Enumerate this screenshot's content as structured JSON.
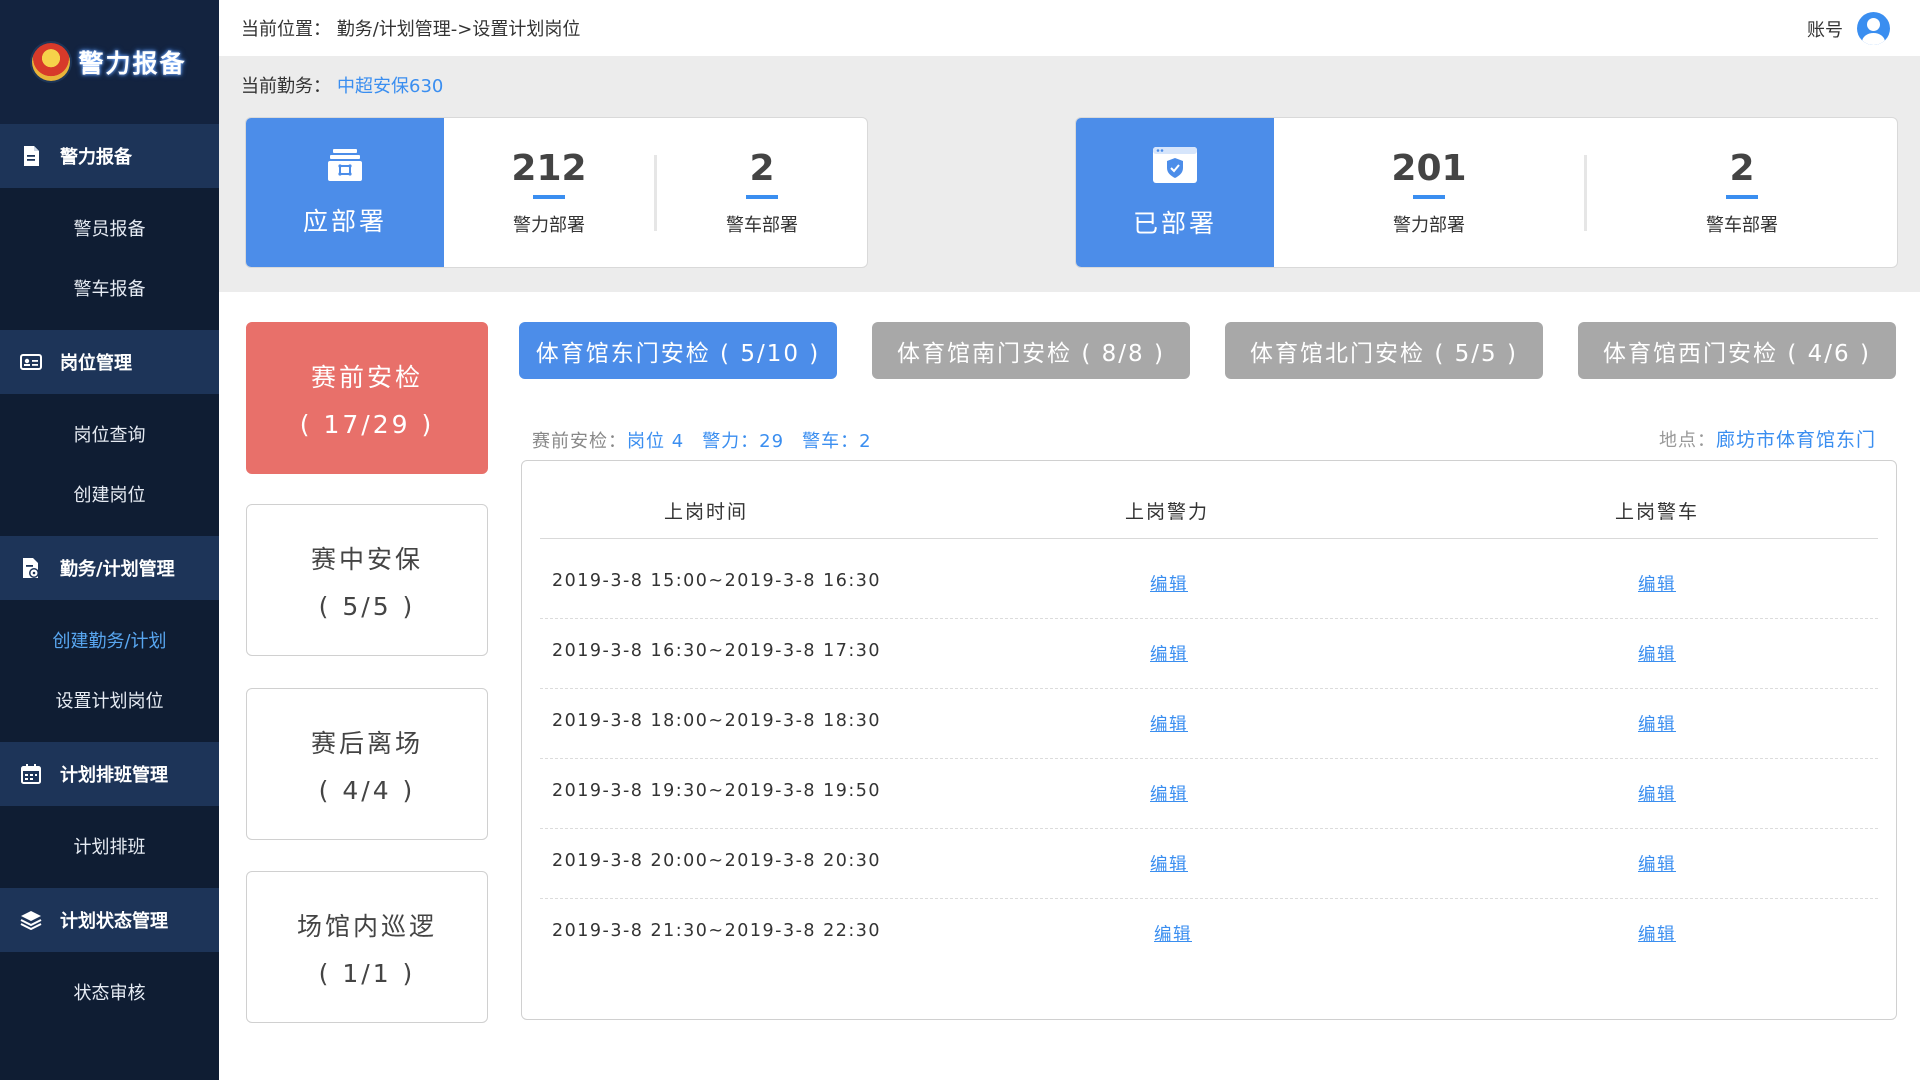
{
  "app": {
    "logo_text": "警力报备"
  },
  "sidebar": {
    "groups": [
      {
        "title": "警力报备",
        "icon": "document-icon",
        "items": [
          "警员报备",
          "警车报备"
        ]
      },
      {
        "title": "岗位管理",
        "icon": "id-card-icon",
        "items": [
          "岗位查询",
          "创建岗位"
        ]
      },
      {
        "title": "勤务/计划管理",
        "icon": "file-gear-icon",
        "items": [
          "创建勤务/计划",
          "设置计划岗位"
        ]
      },
      {
        "title": "计划排班管理",
        "icon": "calendar-icon",
        "items": [
          "计划排班"
        ]
      },
      {
        "title": "计划状态管理",
        "icon": "layers-icon",
        "items": [
          "状态审核"
        ]
      }
    ],
    "active_item": "创建勤务/计划"
  },
  "header": {
    "breadcrumb": "当前位置：  勤务/计划管理->设置计划岗位",
    "account_label": "账号"
  },
  "task": {
    "label": "当前勤务：",
    "name": "中超安保630"
  },
  "stats": {
    "should": {
      "title": "应部署",
      "police_count": "212",
      "police_label": "警力部署",
      "car_count": "2",
      "car_label": "警车部署"
    },
    "done": {
      "title": "已部署",
      "police_count": "201",
      "police_label": "警力部署",
      "car_count": "2",
      "car_label": "警车部署"
    }
  },
  "categories": [
    {
      "name": "赛前安检",
      "count": "( 17/29 )",
      "active": true
    },
    {
      "name": "赛中安保",
      "count": "( 5/5 )",
      "active": false
    },
    {
      "name": "赛后离场",
      "count": "( 4/4 )",
      "active": false
    },
    {
      "name": "场馆内巡逻",
      "count": "( 1/1 )",
      "active": false
    }
  ],
  "gates": [
    {
      "label": "体育馆东门安检 ( 5/10 )",
      "active": true
    },
    {
      "label": "体育馆南门安检 ( 8/8 )",
      "active": false
    },
    {
      "label": "体育馆北门安检 ( 5/5 )",
      "active": false
    },
    {
      "label": "体育馆西门安检 ( 4/6 )",
      "active": false
    }
  ],
  "summary": {
    "prefix": "赛前安检：",
    "posts": "岗位 4",
    "police": "警力：29",
    "cars": "警车：2",
    "location_label": "地点：",
    "location": "廊坊市体育馆东门"
  },
  "table": {
    "headers": [
      "上岗时间",
      "上岗警力",
      "上岗警车"
    ],
    "rows": [
      {
        "time": "2019-3-8 15:00~2019-3-8 16:30",
        "police": "编辑",
        "car": "编辑"
      },
      {
        "time": "2019-3-8 16:30~2019-3-8 17:30",
        "police": "编辑",
        "car": "编辑"
      },
      {
        "time": "2019-3-8 18:00~2019-3-8 18:30",
        "police": "编辑",
        "car": "编辑"
      },
      {
        "time": "2019-3-8 19:30~2019-3-8 19:50",
        "police": "编辑",
        "car": "编辑"
      },
      {
        "time": "2019-3-8 20:00~2019-3-8 20:30",
        "police": "编辑",
        "car": "编辑"
      },
      {
        "time": "2019-3-8 21:30~2019-3-8 22:30",
        "police": "编辑",
        "car": "编辑"
      }
    ]
  },
  "colors": {
    "primary": "#4c8de9",
    "active_category": "#e8706a",
    "sidebar": "#0f1d33",
    "link": "#3a8ef0"
  }
}
